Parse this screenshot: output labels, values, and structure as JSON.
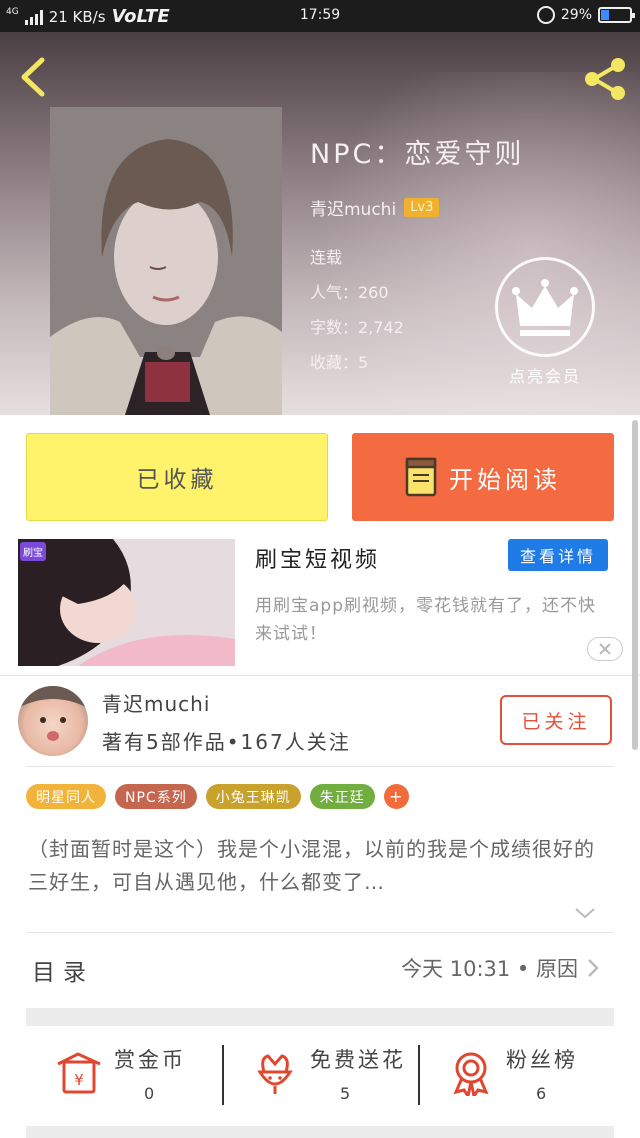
{
  "status_bar": {
    "network": "4G",
    "speed": "21 KB/s",
    "volte": "VoLTE",
    "time": "17:59",
    "battery": "29%",
    "battery_level": 0.29
  },
  "book": {
    "title": "NPC：恋爱守则",
    "author": "青迟muchi",
    "level": "Lv3",
    "status": "连载",
    "popularity": "人气：260",
    "word_count": "字数：2,742",
    "favorites": "收藏：5"
  },
  "vip": {
    "label": "点亮会员"
  },
  "actions": {
    "collected_label": "已收藏",
    "read_label": "开始阅读"
  },
  "ad": {
    "badge": "刷宝",
    "title": "刷宝短视频",
    "details_label": "查看详情",
    "description": "用刷宝app刷视频，零花钱就有了，还不快来试试！"
  },
  "author_card": {
    "name": "青迟muchi",
    "stats": "著有5部作品•167人关注",
    "follow_label": "已关注"
  },
  "tags": [
    {
      "label": "明星同人",
      "color": "#f2b33a"
    },
    {
      "label": "NPC系列",
      "color": "#c5664f"
    },
    {
      "label": "小兔王琳凯",
      "color": "#c9a22e"
    },
    {
      "label": "朱正廷",
      "color": "#72ad3f"
    },
    {
      "label": "+",
      "color": "#f26b3a"
    }
  ],
  "synopsis": "（封面暂时是这个）我是个小混混，以前的我是个成绩很好的三好生，可自从遇见他，什么都变了…",
  "toc": {
    "label": "目录",
    "latest": "今天 10:31 • 原因"
  },
  "bottom_actions": [
    {
      "icon": "red-envelope-icon",
      "label": "赏金币",
      "value": "0"
    },
    {
      "icon": "flower-icon",
      "label": "免费送花",
      "value": "5"
    },
    {
      "icon": "ribbon-badge-icon",
      "label": "粉丝榜",
      "value": "6"
    }
  ]
}
